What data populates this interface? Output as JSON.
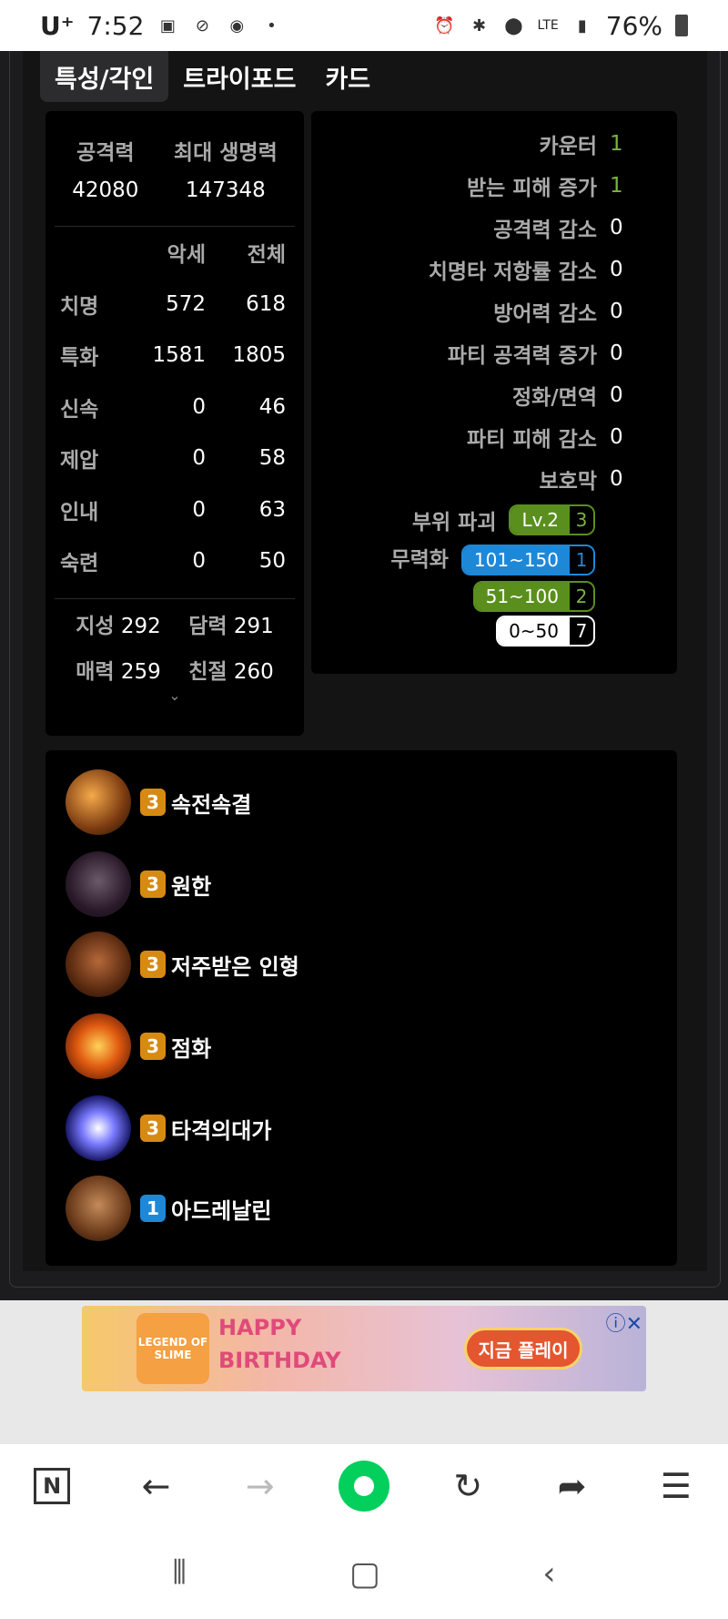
{
  "status": {
    "carrier": "U⁺",
    "time": "7:52",
    "battery": "76%",
    "net": "LTE"
  },
  "tabs": [
    "특성/각인",
    "트라이포드",
    "카드"
  ],
  "stats": {
    "attack_label": "공격력",
    "attack_value": "42080",
    "hp_label": "최대 생명력",
    "hp_value": "147348",
    "head_a": "악세",
    "head_b": "전체",
    "rows": [
      {
        "name": "치명",
        "a": "572",
        "b": "618"
      },
      {
        "name": "특화",
        "a": "1581",
        "b": "1805"
      },
      {
        "name": "신속",
        "a": "0",
        "b": "46"
      },
      {
        "name": "제압",
        "a": "0",
        "b": "58"
      },
      {
        "name": "인내",
        "a": "0",
        "b": "63"
      },
      {
        "name": "숙련",
        "a": "0",
        "b": "50"
      }
    ],
    "attrs": [
      {
        "k": "지성",
        "v": "292"
      },
      {
        "k": "담력",
        "v": "291"
      },
      {
        "k": "매력",
        "v": "259"
      },
      {
        "k": "친절",
        "v": "260"
      }
    ],
    "expand": "⌄"
  },
  "buffs": {
    "rows": [
      {
        "label": "카운터",
        "value": "1"
      },
      {
        "label": "받는 피해 증가",
        "value": "1"
      },
      {
        "label": "공격력 감소",
        "value": "0"
      },
      {
        "label": "치명타 저항률 감소",
        "value": "0"
      },
      {
        "label": "방어력 감소",
        "value": "0"
      },
      {
        "label": "파티 공격력 증가",
        "value": "0"
      },
      {
        "label": "정화/면역",
        "value": "0"
      },
      {
        "label": "파티 피해 감소",
        "value": "0"
      },
      {
        "label": "보호막",
        "value": "0"
      }
    ],
    "part_break_label": "부위 파괴",
    "part_break_lv": "Lv.2",
    "part_break_count": "3",
    "stagger_label": "무력화",
    "stagger": [
      {
        "range": "101~150",
        "count": "1"
      },
      {
        "range": "51~100",
        "count": "2"
      },
      {
        "range": "0~50",
        "count": "7"
      }
    ]
  },
  "engravings": [
    {
      "level": "3",
      "name": "속전속결",
      "icon": "engraving-swift-icon"
    },
    {
      "level": "3",
      "name": "원한",
      "icon": "engraving-grudge-icon"
    },
    {
      "level": "3",
      "name": "저주받은 인형",
      "icon": "engraving-cursed-doll-icon"
    },
    {
      "level": "3",
      "name": "점화",
      "icon": "engraving-ignite-icon"
    },
    {
      "level": "3",
      "name": "타격의대가",
      "icon": "engraving-hit-master-icon"
    },
    {
      "level": "1",
      "name": "아드레날린",
      "icon": "engraving-adrenaline-icon"
    }
  ],
  "ad": {
    "logo": "LEGEND OF SLIME",
    "line1": "HAPPY",
    "line2": "BIRTHDAY",
    "cta": "지금 플레이"
  },
  "colors": {
    "orange_badge": "#d78a12",
    "blue_badge": "#1e88d8",
    "green_value": "#7cb342"
  }
}
